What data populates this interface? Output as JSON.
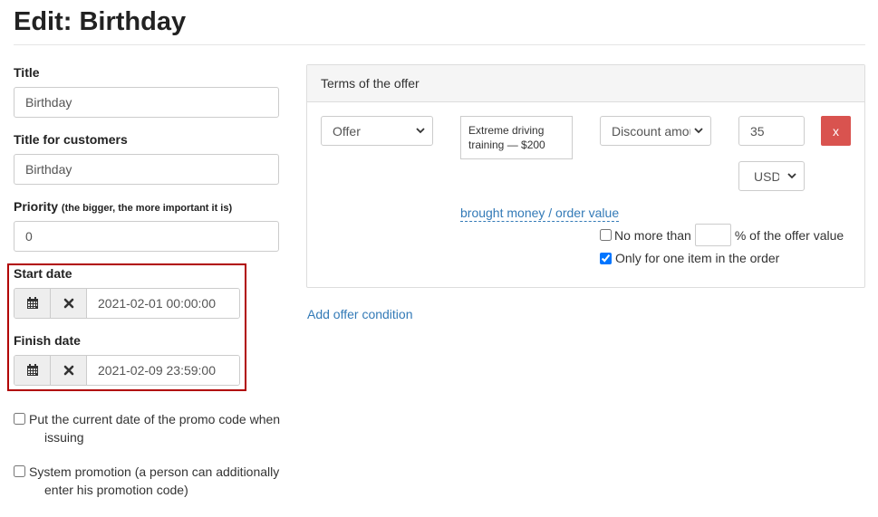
{
  "page": {
    "title": "Edit: Birthday"
  },
  "form": {
    "title_label": "Title",
    "title_value": "Birthday",
    "customer_title_label": "Title for customers",
    "customer_title_value": "Birthday",
    "priority_label": "Priority",
    "priority_hint": "(the bigger, the more important it is)",
    "priority_value": "0",
    "start_label": "Start date",
    "start_value": "2021-02-01 00:00:00",
    "finish_label": "Finish date",
    "finish_value": "2021-02-09 23:59:00",
    "current_date_label_1": "Put the current date of the promo code when",
    "current_date_label_2": "issuing",
    "system_promo_label_1": "System promotion (a person can additionally",
    "system_promo_label_2": "enter his promotion code)"
  },
  "terms": {
    "header": "Terms of the offer",
    "type_select": "Offer",
    "offer_item": "Extreme driving training — $200",
    "discount_select": "Discount amou",
    "amount": "35",
    "currency_select": "USD",
    "remove_label": "x",
    "basis_link": "brought money / order value",
    "no_more_than_label": "No more than",
    "no_more_than_value": "",
    "no_more_than_suffix": "% of the offer value",
    "one_item_label": "Only for one item in the order",
    "one_item_checked": true,
    "no_more_than_checked": false
  },
  "actions": {
    "add_condition": "Add offer condition"
  },
  "colors": {
    "accent": "#337ab7",
    "danger": "#d9534f",
    "highlight": "#b10000"
  },
  "icons": [
    "calendar-icon",
    "clear-icon",
    "chevron-down-icon"
  ]
}
